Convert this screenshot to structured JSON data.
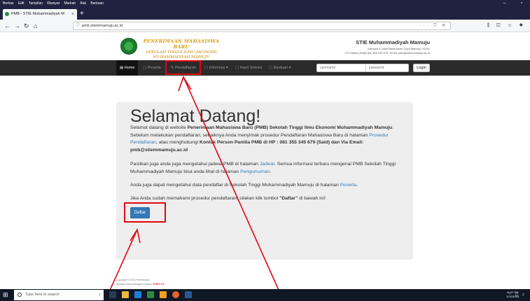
{
  "browser": {
    "menu": [
      "Berkas",
      "Edit",
      "Tampilan",
      "Riwayat",
      "Markah",
      "Alat",
      "Bantuan"
    ],
    "tab_title": "PMB - STIE Muhammadiyah M",
    "url": "pmb.stiemmamuju.ac.id"
  },
  "header": {
    "logo_line1": "PENERIMAAN MAHASISWA BARU",
    "logo_line2": "SEKOLAH TINGGI ILMU EKONOMI",
    "logo_line3": "MUHAMMADIYAH MAMUJU",
    "inst_name": "STIE Muhammadiyah Mamuju",
    "inst_address": "Kampus II Jalan Baharuddin Lopa Mamuju, 91511",
    "inst_contact": "CP Panitia (Said) 081 355 345 679. Email: pmb@stiemmamuju.ac.id"
  },
  "nav": {
    "home": "Home",
    "peserta": "Peserta",
    "pendaftaran": "Pendaftaran",
    "informasi": "Informasi",
    "hasil_seleksi": "Hasil Seleksi",
    "bantuan": "Bantuan",
    "username_placeholder": "username",
    "password_placeholder": "password",
    "login": "Login"
  },
  "jumbotron": {
    "title": "Selamat Datang!",
    "p1_a": "Selamat datang di website ",
    "p1_b": "Penerimaan Mahasiswa Baru (PMB) Sekolah Tinggi Ilmu Ekonomi Muhammadiyah Mamuju",
    "p1_c": ". Sebelum melakukan pendaftaran, sebaiknya Anda menyimak prosedur Pendaftaran Mahasiswa Baru di halaman ",
    "p1_link": "Prosedur Pendaftaran",
    "p1_d": ", atau menghubungi ",
    "p1_e": "Kontak Person Panitia PMB di HP : 081 355 345 679 (Said) dan Via Email: pmb@stiemmamuju.ac.id",
    "p2_a": "Pastikan juga anda juga mengetahui jadwal PMB di halaman ",
    "p2_link1": "Jadwal",
    "p2_b": ". Semua informasi terbaru mengenai PMB Sekolah Tinggi Muhammadiyah Mamuju bisa anda lihat di halaman ",
    "p2_link2": "Pengumuman",
    "p2_c": ".",
    "p3_a": "Anda juga dapat mengetahui data pendaftar di Sekolah Tinggi Muhammadiyah Mamuju di halaman ",
    "p3_link": "Peserta",
    "p3_b": ".",
    "p4_a": "Jika Anda sudah memahami prosedur pendaftaran, silakan klik tombol ",
    "p4_b": "\"Daftar\"",
    "p4_c": " di bawah ini!",
    "button": "Daftar"
  },
  "footer": {
    "copyright": "Copyright © 2016 Penerimaan...",
    "version_label": "Aplikasi untuk Kalangan Kampus ",
    "version": "VERSI 2.0"
  },
  "taskbar": {
    "search_placeholder": "Type here to search",
    "time": "11:27 PM",
    "date": "1/22/2018"
  },
  "colors": {
    "annotation": "#e30613",
    "primary_button": "#337ab7",
    "navbar": "#2b2b2b"
  }
}
